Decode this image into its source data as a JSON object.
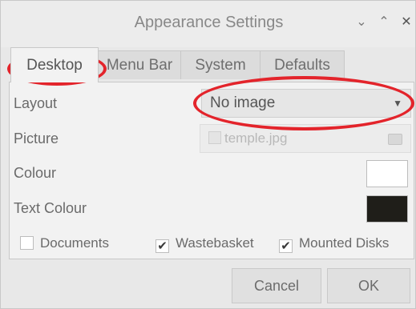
{
  "window": {
    "title": "Appearance Settings",
    "controls": {
      "minimize": "⌄",
      "maximize": "⌃",
      "close": "✕"
    }
  },
  "tabs": [
    {
      "label": "Desktop",
      "active": true
    },
    {
      "label": "Menu Bar",
      "active": false
    },
    {
      "label": "System",
      "active": false
    },
    {
      "label": "Defaults",
      "active": false
    }
  ],
  "desktop": {
    "layout_label": "Layout",
    "layout_value": "No image",
    "picture_label": "Picture",
    "picture_value": "temple.jpg",
    "colour_label": "Colour",
    "colour_value": "#ffffff",
    "text_colour_label": "Text Colour",
    "text_colour_value": "#1f1e19",
    "checkboxes": [
      {
        "label": "Documents",
        "checked": false
      },
      {
        "label": "Wastebasket",
        "checked": true
      },
      {
        "label": "Mounted Disks",
        "checked": true
      }
    ]
  },
  "buttons": {
    "cancel": "Cancel",
    "ok": "OK"
  },
  "colors": {
    "annotation": "#e3242b"
  }
}
